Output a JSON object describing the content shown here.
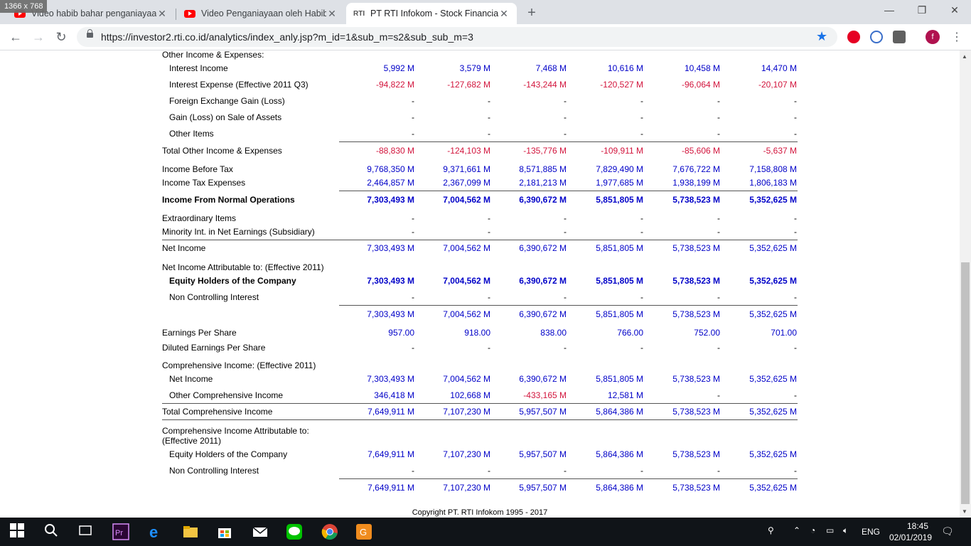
{
  "badge": "1366 x 768",
  "tabs": [
    {
      "title": "Video habib bahar penganiayaan",
      "icon": "youtube-icon"
    },
    {
      "title": "Video Penganiayaan oleh Habib",
      "icon": "youtube-icon"
    },
    {
      "title": "PT RTI Infokom - Stock Financial",
      "icon": "rti-icon"
    }
  ],
  "url": "https://investor2.rti.co.id/analytics/index_anly.jsp?m_id=1&sub_m=s2&sub_sub_m=3",
  "avatar_letter": "f",
  "rows": [
    {
      "label": "Other Income & Expenses:",
      "indent": false,
      "bold": false,
      "values": []
    },
    {
      "label": "Interest Income",
      "indent": true,
      "bold": false,
      "values": [
        "5,992 M",
        "3,579 M",
        "7,468 M",
        "10,616 M",
        "10,458 M",
        "14,470 M"
      ]
    },
    {
      "label": "Interest Expense (Effective 2011 Q3)",
      "indent": true,
      "bold": false,
      "values": [
        "-94,822 M",
        "-127,682 M",
        "-143,244 M",
        "-120,527 M",
        "-96,064 M",
        "-20,107 M"
      ]
    },
    {
      "label": "Foreign Exchange Gain (Loss)",
      "indent": true,
      "bold": false,
      "values": [
        "-",
        "-",
        "-",
        "-",
        "-",
        "-"
      ]
    },
    {
      "label": "Gain (Loss) on Sale of Assets",
      "indent": true,
      "bold": false,
      "values": [
        "-",
        "-",
        "-",
        "-",
        "-",
        "-"
      ]
    },
    {
      "label": "Other Items",
      "indent": true,
      "bold": false,
      "values": [
        "-",
        "-",
        "-",
        "-",
        "-",
        "-"
      ]
    },
    {
      "label": "Total Other Income & Expenses",
      "indent": false,
      "bold": false,
      "values": [
        "-88,830 M",
        "-124,103 M",
        "-135,776 M",
        "-109,911 M",
        "-85,606 M",
        "-5,637 M"
      ]
    },
    {
      "label": "Income Before Tax",
      "indent": false,
      "bold": false,
      "values": [
        "9,768,350 M",
        "9,371,661 M",
        "8,571,885 M",
        "7,829,490 M",
        "7,676,722 M",
        "7,158,808 M"
      ]
    },
    {
      "label": "Income Tax Expenses",
      "indent": false,
      "bold": false,
      "values": [
        "2,464,857 M",
        "2,367,099 M",
        "2,181,213 M",
        "1,977,685 M",
        "1,938,199 M",
        "1,806,183 M"
      ]
    },
    {
      "label": "Income From Normal Operations",
      "indent": false,
      "bold": true,
      "values": [
        "7,303,493 M",
        "7,004,562 M",
        "6,390,672 M",
        "5,851,805 M",
        "5,738,523 M",
        "5,352,625 M"
      ]
    },
    {
      "label": "Extraordinary Items",
      "indent": false,
      "bold": false,
      "values": [
        "-",
        "-",
        "-",
        "-",
        "-",
        "-"
      ]
    },
    {
      "label": "Minority Int. in Net Earnings (Subsidiary)",
      "indent": false,
      "bold": false,
      "values": [
        "-",
        "-",
        "-",
        "-",
        "-",
        "-"
      ]
    },
    {
      "label": "Net Income",
      "indent": false,
      "bold": false,
      "values": [
        "7,303,493 M",
        "7,004,562 M",
        "6,390,672 M",
        "5,851,805 M",
        "5,738,523 M",
        "5,352,625 M"
      ]
    },
    {
      "label": "Net Income Attributable to: (Effective 2011)",
      "indent": false,
      "bold": false,
      "values": []
    },
    {
      "label": "Equity Holders of the Company",
      "indent": true,
      "bold": true,
      "values": [
        "7,303,493 M",
        "7,004,562 M",
        "6,390,672 M",
        "5,851,805 M",
        "5,738,523 M",
        "5,352,625 M"
      ]
    },
    {
      "label": "Non Controlling Interest",
      "indent": true,
      "bold": false,
      "values": [
        "-",
        "-",
        "-",
        "-",
        "-",
        "-"
      ]
    },
    {
      "label": "",
      "indent": false,
      "bold": false,
      "values": [
        "7,303,493 M",
        "7,004,562 M",
        "6,390,672 M",
        "5,851,805 M",
        "5,738,523 M",
        "5,352,625 M"
      ]
    },
    {
      "label": "Earnings Per Share",
      "indent": false,
      "bold": false,
      "values": [
        "957.00",
        "918.00",
        "838.00",
        "766.00",
        "752.00",
        "701.00"
      ]
    },
    {
      "label": "Diluted Earnings Per Share",
      "indent": false,
      "bold": false,
      "values": [
        "-",
        "-",
        "-",
        "-",
        "-",
        "-"
      ]
    },
    {
      "label": "Comprehensive Income: (Effective 2011)",
      "indent": false,
      "bold": false,
      "values": []
    },
    {
      "label": "Net Income",
      "indent": true,
      "bold": false,
      "values": [
        "7,303,493 M",
        "7,004,562 M",
        "6,390,672 M",
        "5,851,805 M",
        "5,738,523 M",
        "5,352,625 M"
      ]
    },
    {
      "label": "Other Comprehensive Income",
      "indent": true,
      "bold": false,
      "values": [
        "346,418 M",
        "102,668 M",
        "-433,165 M",
        "12,581 M",
        "-",
        "-"
      ]
    },
    {
      "label": "Total Comprehensive Income",
      "indent": false,
      "bold": false,
      "values": [
        "7,649,911 M",
        "7,107,230 M",
        "5,957,507 M",
        "5,864,386 M",
        "5,738,523 M",
        "5,352,625 M"
      ]
    },
    {
      "label": "Comprehensive Income Attributable to:",
      "indent": false,
      "bold": false,
      "values": []
    },
    {
      "label": "(Effective 2011)",
      "indent": false,
      "bold": false,
      "values": []
    },
    {
      "label": "Equity Holders of the Company",
      "indent": true,
      "bold": false,
      "values": [
        "7,649,911 M",
        "7,107,230 M",
        "5,957,507 M",
        "5,864,386 M",
        "5,738,523 M",
        "5,352,625 M"
      ]
    },
    {
      "label": "Non Controlling Interest",
      "indent": true,
      "bold": false,
      "values": [
        "-",
        "-",
        "-",
        "-",
        "-",
        "-"
      ]
    },
    {
      "label": "",
      "indent": false,
      "bold": false,
      "values": [
        "7,649,911 M",
        "7,107,230 M",
        "5,957,507 M",
        "5,864,386 M",
        "5,738,523 M",
        "5,352,625 M"
      ]
    }
  ],
  "copyright": "Copyright PT. RTI Infokom 1995 - 2017",
  "taskbar": {
    "language": "ENG",
    "time": "18:45",
    "date": "02/01/2019"
  },
  "colors": {
    "positive": "#0000c8",
    "negative": "#d2143c"
  }
}
